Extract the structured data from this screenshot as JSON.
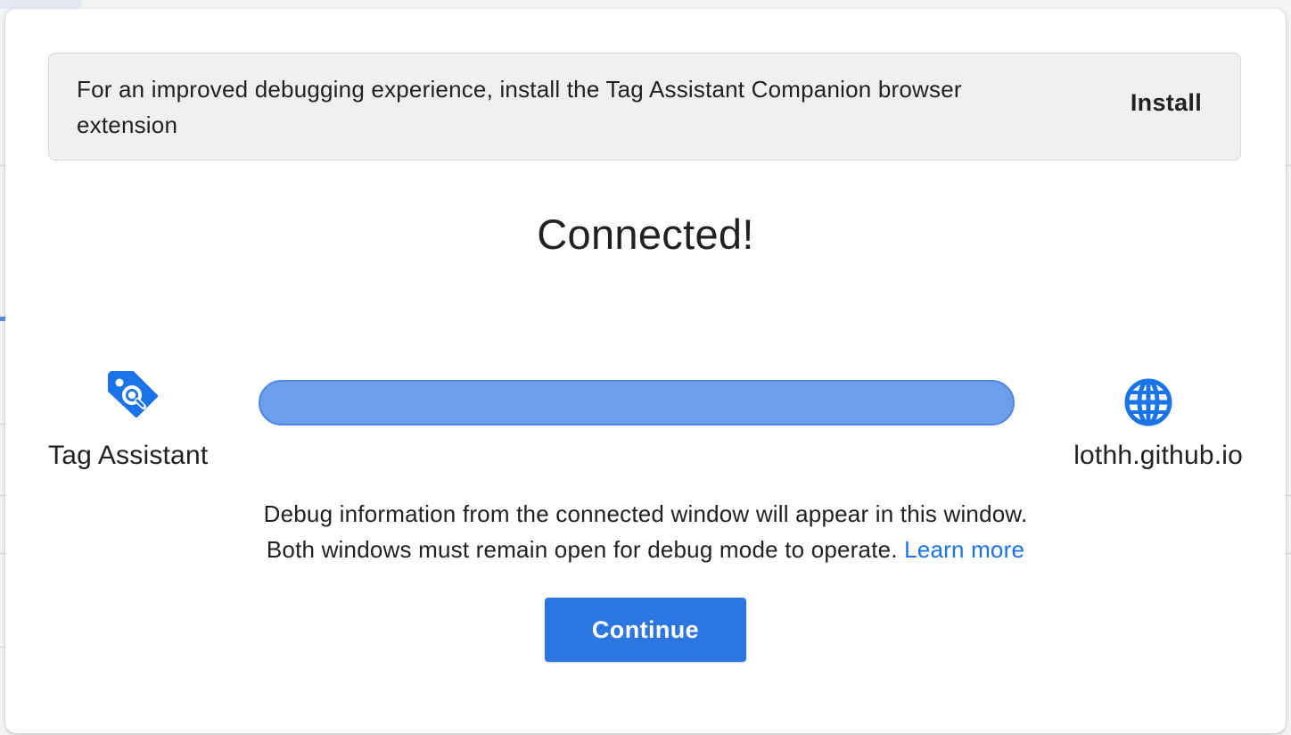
{
  "banner": {
    "message": "For an improved debugging experience, install the Tag Assistant Companion browser extension",
    "install_label": "Install"
  },
  "dialog": {
    "title": "Connected!",
    "source_label": "Tag Assistant",
    "source_icon": "tag-assistant-icon",
    "target_label": "lothh.github.io",
    "target_icon": "globe-icon",
    "connection_progress": 1.0,
    "info_line1": "Debug information from the connected window will appear in this window.",
    "info_line2": "Both windows must remain open for debug mode to operate.",
    "learn_more_label": "Learn more",
    "continue_label": "Continue"
  },
  "colors": {
    "accent": "#1a73e8",
    "button": "#2c76e2",
    "progress_fill": "#6c9eec",
    "banner_bg": "#f0f0f0"
  }
}
